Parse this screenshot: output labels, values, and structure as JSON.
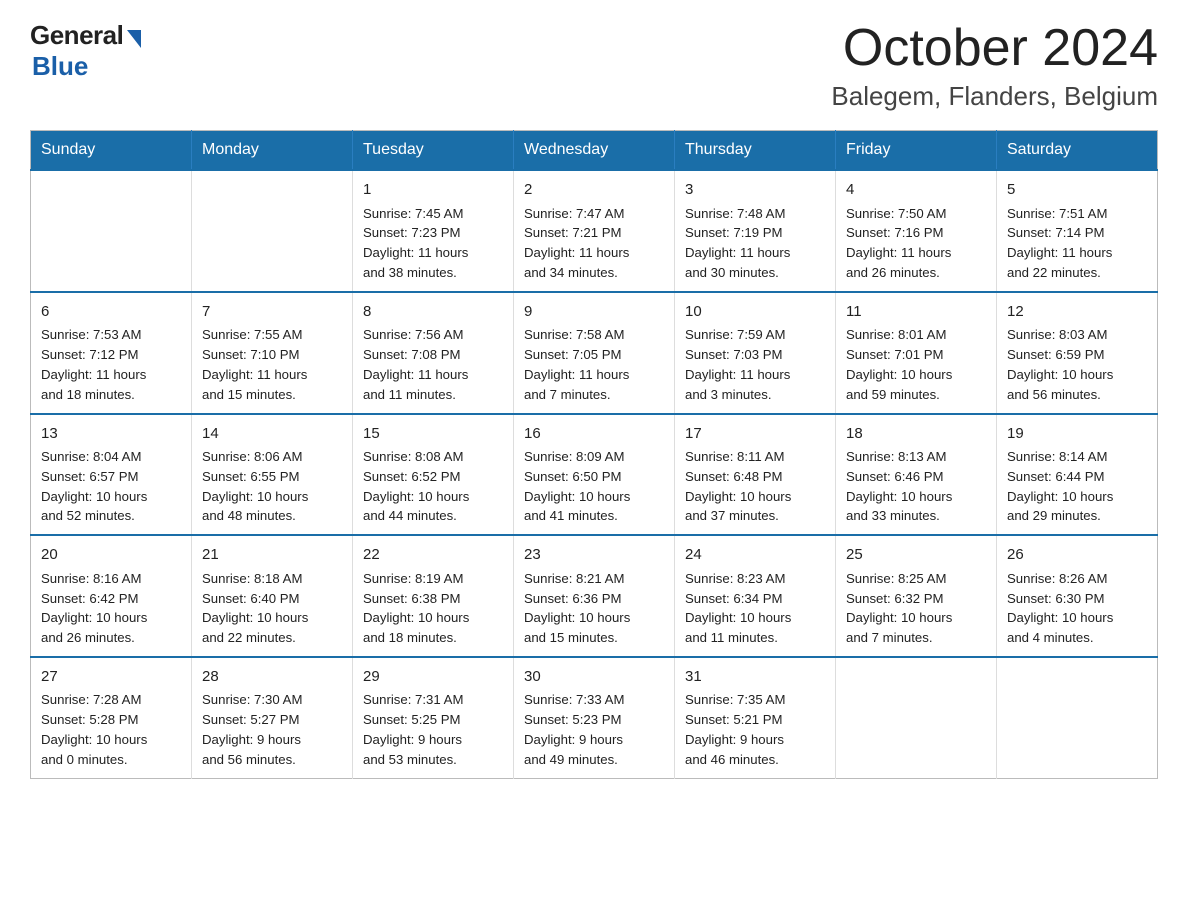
{
  "header": {
    "logo_general": "General",
    "logo_blue": "Blue",
    "month_title": "October 2024",
    "location": "Balegem, Flanders, Belgium"
  },
  "weekdays": [
    "Sunday",
    "Monday",
    "Tuesday",
    "Wednesday",
    "Thursday",
    "Friday",
    "Saturday"
  ],
  "weeks": [
    [
      {
        "day": "",
        "info": ""
      },
      {
        "day": "",
        "info": ""
      },
      {
        "day": "1",
        "info": "Sunrise: 7:45 AM\nSunset: 7:23 PM\nDaylight: 11 hours\nand 38 minutes."
      },
      {
        "day": "2",
        "info": "Sunrise: 7:47 AM\nSunset: 7:21 PM\nDaylight: 11 hours\nand 34 minutes."
      },
      {
        "day": "3",
        "info": "Sunrise: 7:48 AM\nSunset: 7:19 PM\nDaylight: 11 hours\nand 30 minutes."
      },
      {
        "day": "4",
        "info": "Sunrise: 7:50 AM\nSunset: 7:16 PM\nDaylight: 11 hours\nand 26 minutes."
      },
      {
        "day": "5",
        "info": "Sunrise: 7:51 AM\nSunset: 7:14 PM\nDaylight: 11 hours\nand 22 minutes."
      }
    ],
    [
      {
        "day": "6",
        "info": "Sunrise: 7:53 AM\nSunset: 7:12 PM\nDaylight: 11 hours\nand 18 minutes."
      },
      {
        "day": "7",
        "info": "Sunrise: 7:55 AM\nSunset: 7:10 PM\nDaylight: 11 hours\nand 15 minutes."
      },
      {
        "day": "8",
        "info": "Sunrise: 7:56 AM\nSunset: 7:08 PM\nDaylight: 11 hours\nand 11 minutes."
      },
      {
        "day": "9",
        "info": "Sunrise: 7:58 AM\nSunset: 7:05 PM\nDaylight: 11 hours\nand 7 minutes."
      },
      {
        "day": "10",
        "info": "Sunrise: 7:59 AM\nSunset: 7:03 PM\nDaylight: 11 hours\nand 3 minutes."
      },
      {
        "day": "11",
        "info": "Sunrise: 8:01 AM\nSunset: 7:01 PM\nDaylight: 10 hours\nand 59 minutes."
      },
      {
        "day": "12",
        "info": "Sunrise: 8:03 AM\nSunset: 6:59 PM\nDaylight: 10 hours\nand 56 minutes."
      }
    ],
    [
      {
        "day": "13",
        "info": "Sunrise: 8:04 AM\nSunset: 6:57 PM\nDaylight: 10 hours\nand 52 minutes."
      },
      {
        "day": "14",
        "info": "Sunrise: 8:06 AM\nSunset: 6:55 PM\nDaylight: 10 hours\nand 48 minutes."
      },
      {
        "day": "15",
        "info": "Sunrise: 8:08 AM\nSunset: 6:52 PM\nDaylight: 10 hours\nand 44 minutes."
      },
      {
        "day": "16",
        "info": "Sunrise: 8:09 AM\nSunset: 6:50 PM\nDaylight: 10 hours\nand 41 minutes."
      },
      {
        "day": "17",
        "info": "Sunrise: 8:11 AM\nSunset: 6:48 PM\nDaylight: 10 hours\nand 37 minutes."
      },
      {
        "day": "18",
        "info": "Sunrise: 8:13 AM\nSunset: 6:46 PM\nDaylight: 10 hours\nand 33 minutes."
      },
      {
        "day": "19",
        "info": "Sunrise: 8:14 AM\nSunset: 6:44 PM\nDaylight: 10 hours\nand 29 minutes."
      }
    ],
    [
      {
        "day": "20",
        "info": "Sunrise: 8:16 AM\nSunset: 6:42 PM\nDaylight: 10 hours\nand 26 minutes."
      },
      {
        "day": "21",
        "info": "Sunrise: 8:18 AM\nSunset: 6:40 PM\nDaylight: 10 hours\nand 22 minutes."
      },
      {
        "day": "22",
        "info": "Sunrise: 8:19 AM\nSunset: 6:38 PM\nDaylight: 10 hours\nand 18 minutes."
      },
      {
        "day": "23",
        "info": "Sunrise: 8:21 AM\nSunset: 6:36 PM\nDaylight: 10 hours\nand 15 minutes."
      },
      {
        "day": "24",
        "info": "Sunrise: 8:23 AM\nSunset: 6:34 PM\nDaylight: 10 hours\nand 11 minutes."
      },
      {
        "day": "25",
        "info": "Sunrise: 8:25 AM\nSunset: 6:32 PM\nDaylight: 10 hours\nand 7 minutes."
      },
      {
        "day": "26",
        "info": "Sunrise: 8:26 AM\nSunset: 6:30 PM\nDaylight: 10 hours\nand 4 minutes."
      }
    ],
    [
      {
        "day": "27",
        "info": "Sunrise: 7:28 AM\nSunset: 5:28 PM\nDaylight: 10 hours\nand 0 minutes."
      },
      {
        "day": "28",
        "info": "Sunrise: 7:30 AM\nSunset: 5:27 PM\nDaylight: 9 hours\nand 56 minutes."
      },
      {
        "day": "29",
        "info": "Sunrise: 7:31 AM\nSunset: 5:25 PM\nDaylight: 9 hours\nand 53 minutes."
      },
      {
        "day": "30",
        "info": "Sunrise: 7:33 AM\nSunset: 5:23 PM\nDaylight: 9 hours\nand 49 minutes."
      },
      {
        "day": "31",
        "info": "Sunrise: 7:35 AM\nSunset: 5:21 PM\nDaylight: 9 hours\nand 46 minutes."
      },
      {
        "day": "",
        "info": ""
      },
      {
        "day": "",
        "info": ""
      }
    ]
  ]
}
